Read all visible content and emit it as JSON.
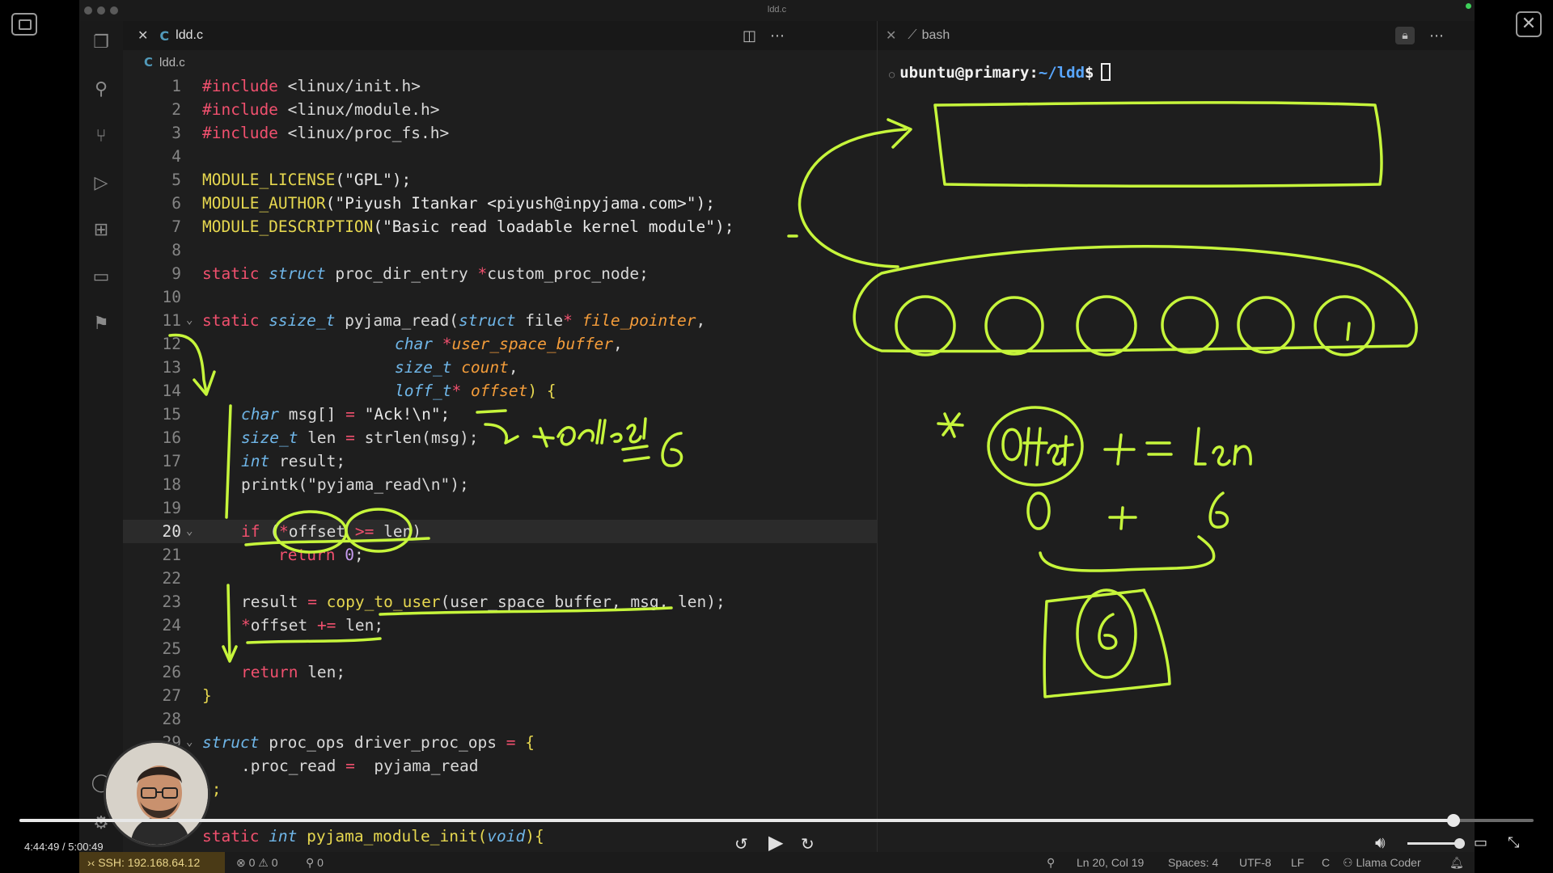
{
  "window": {
    "title": "ldd.c"
  },
  "editor": {
    "tab_label": "ldd.c",
    "breadcrumb": "ldd.c",
    "lines": [
      {
        "n": "1"
      },
      {
        "n": "2"
      },
      {
        "n": "3"
      },
      {
        "n": "4"
      },
      {
        "n": "5"
      },
      {
        "n": "6"
      },
      {
        "n": "7"
      },
      {
        "n": "8"
      },
      {
        "n": "9"
      },
      {
        "n": "10"
      },
      {
        "n": "11"
      },
      {
        "n": "12"
      },
      {
        "n": "13"
      },
      {
        "n": "14"
      },
      {
        "n": "15"
      },
      {
        "n": "16"
      },
      {
        "n": "17"
      },
      {
        "n": "18"
      },
      {
        "n": "19"
      },
      {
        "n": "20"
      },
      {
        "n": "21"
      },
      {
        "n": "22"
      },
      {
        "n": "23"
      },
      {
        "n": "24"
      },
      {
        "n": "25"
      },
      {
        "n": "26"
      },
      {
        "n": "27"
      },
      {
        "n": "28"
      },
      {
        "n": "29"
      }
    ],
    "code": {
      "l1a": "#include",
      "l1b": " <linux/init.h>",
      "l2a": "#include",
      "l2b": " <linux/module.h>",
      "l3a": "#include",
      "l3b": " <linux/proc_fs.h>",
      "l5a": "MODULE_LICENSE",
      "l5b": "(\"GPL\");",
      "l6a": "MODULE_AUTHOR",
      "l6b": "(\"Piyush Itankar <piyush@inpyjama.com>\");",
      "l7a": "MODULE_DESCRIPTION",
      "l7b": "(\"Basic read loadable kernel module\");",
      "l9a": "static ",
      "l9b": "struct",
      "l9c": " proc_dir_entry ",
      "l9d": "*",
      "l9e": "custom_proc_node;",
      "l11a": "static ",
      "l11b": "ssize_t",
      "l11c": " pyjama_read(",
      "l11d": "struct",
      "l11e": " file",
      "l11f": "* ",
      "l11g": "file_pointer",
      ",": ",",
      "l12a": "char ",
      "l12b": "*",
      "l12c": "user_space_buffer",
      "l13a": "size_t ",
      "l13b": "count",
      "l14a": "loff_t",
      "l14b": "* ",
      "l14c": "offset",
      ") {": ") {",
      "l15a": "char",
      " msg": " msg[] ",
      "=": "= ",
      "l15b": "\"Ack!\\n\";",
      "l16a": "size_t",
      " len": " len ",
      "l16b": "strlen(msg);",
      "l17a": "int",
      " result": " result;",
      "l18a": "printk(\"pyjama_read\\n\");",
      "l20a": "if",
      " (": " (",
      "l20b": "*",
      "l20c": "offset ",
      "l20d": ">=",
      "l20e": " len)",
      "l21a": "return ",
      "l21b": "0",
      ";": ";",
      "l23a": "result ",
      "l23b": "copy_to_user",
      "l23c": "(user_space_buffer, msg, len);",
      "l24a": "*",
      "l24b": "offset ",
      "l24c": "+=",
      "l24d": " len;",
      "l26a": "return",
      " len2": " len;",
      "l27a": "}",
      "l29a": "struct",
      " proc_ops": " proc_ops driver_proc_ops ",
      "l29b": "{",
      "l30a": ".proc_read ",
      "l30b": " pyjama_read",
      "l31a": "};",
      "l32a": "static ",
      "l32b": "int",
      " pyjama_module_init(": " pyjama_module_init(",
      "l32c": "void",
      "){": "){"
    }
  },
  "terminal": {
    "tab_label": "bash",
    "user_host": "ubuntu@primary",
    "colon": ":",
    "path": "~/ldd",
    "symbol": "$"
  },
  "status_bar": {
    "ssh": "SSH: 192.168.64.12",
    "errors": "0",
    "warnings": "0",
    "ports": "0",
    "position": "Ln 20, Col 19",
    "spaces": "Spaces: 4",
    "encoding": "UTF-8",
    "eol": "LF",
    "language": "C",
    "extension": "Llama Coder"
  },
  "player": {
    "time": "4:44:49 / 5:00:49",
    "progress_fraction": 0.947
  },
  "colors": {
    "ink": "#c6f53b",
    "keyword": "#f0506e",
    "type": "#6fb6e8",
    "function": "#e6d74f"
  }
}
